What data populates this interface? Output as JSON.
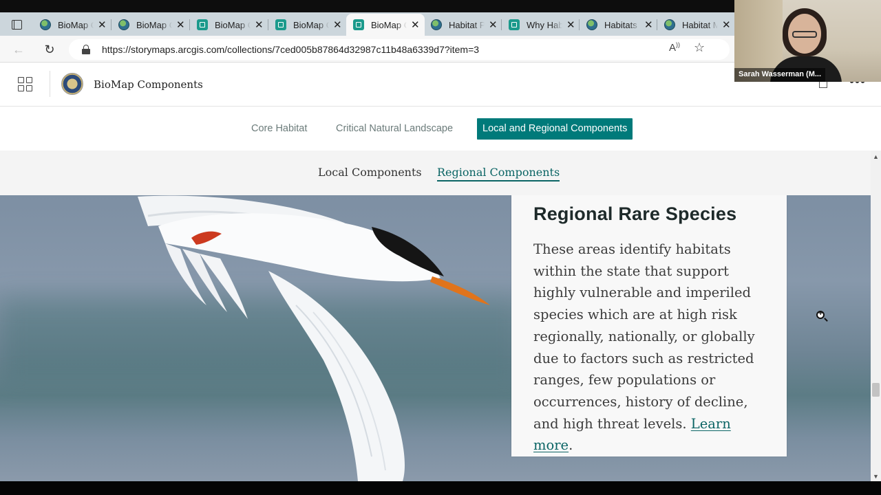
{
  "browser": {
    "tabs": [
      {
        "label": "BioMap Components",
        "icon": "globe-icon",
        "active": false
      },
      {
        "label": "BioMap Core Habitat",
        "icon": "globe-icon",
        "active": false
      },
      {
        "label": "BioMap Critical Natural Landscape",
        "icon": "storymap-icon",
        "active": false
      },
      {
        "label": "BioMap Components",
        "icon": "storymap-icon",
        "active": false
      },
      {
        "label": "BioMap Components",
        "icon": "storymap-icon",
        "active": true
      },
      {
        "label": "Habitat Priorities",
        "icon": "globe-icon",
        "active": false
      },
      {
        "label": "Why Habitat",
        "icon": "storymap-icon",
        "active": false
      },
      {
        "label": "Habitats",
        "icon": "globe-icon",
        "active": false
      },
      {
        "label": "Habitat Map",
        "icon": "globe-icon",
        "active": false
      }
    ],
    "url": "https://storymaps.arcgis.com/collections/7ced005b87864d32987c11b48a6339d7?item=3"
  },
  "webcam": {
    "name": "Sarah Wasserman (M..."
  },
  "header": {
    "title": "BioMap Components"
  },
  "primary_nav": [
    {
      "label": "Core Habitat",
      "active": false
    },
    {
      "label": "Critical Natural Landscape",
      "active": false
    },
    {
      "label": "Local and Regional Components",
      "active": true
    }
  ],
  "secondary_nav": [
    {
      "label": "Local Components",
      "active": false
    },
    {
      "label": "Regional Components",
      "active": true
    }
  ],
  "panel": {
    "title": "Regional Rare Species",
    "body": "These areas identify habitats within the state that support highly vulnerable and imperiled species which are at high risk regionally, nationally, or globally due to factors such as restricted ranges, few populations or occurrences, history of decline, and high threat levels.",
    "link": "Learn more",
    "link_suffix": "."
  },
  "colors": {
    "accent": "#007a7a",
    "link": "#0a6464"
  }
}
